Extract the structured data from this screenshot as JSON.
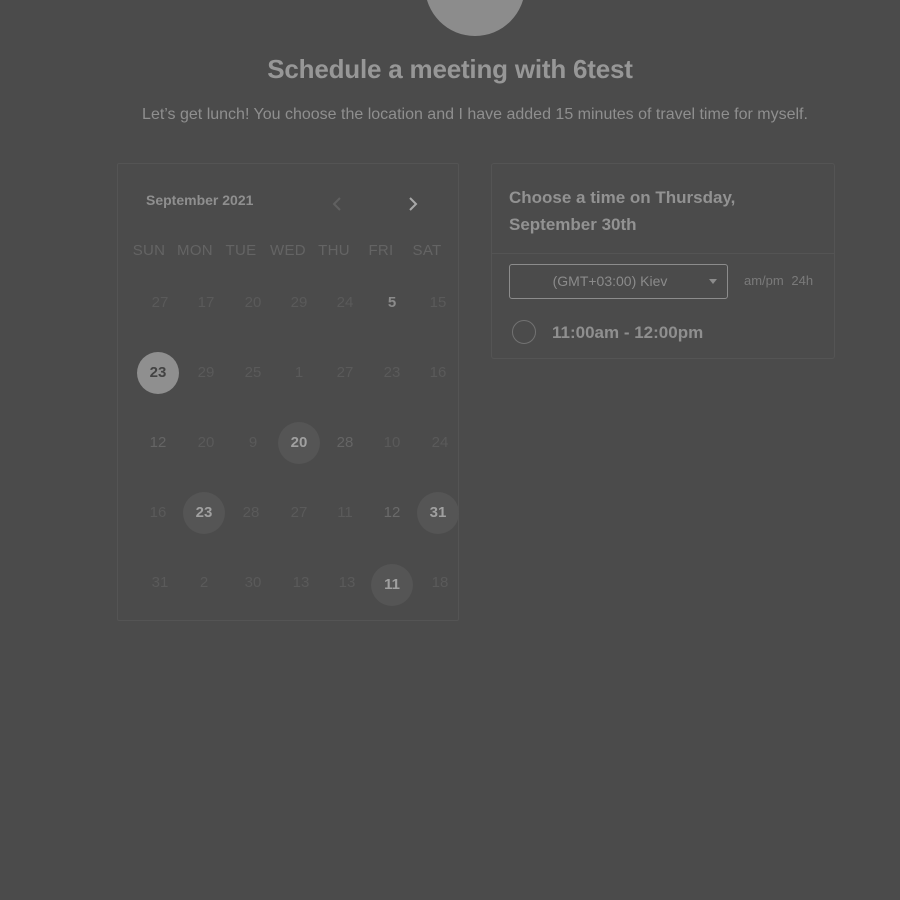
{
  "header": {
    "title": "Schedule a meeting with 6test",
    "subtitle": "Let’s get lunch! You choose the location and I have added 15 minutes of travel time for myself."
  },
  "calendar": {
    "month_label": "September 2021",
    "weekdays": [
      "SUN",
      "MON",
      "TUE",
      "WED",
      "THU",
      "FRI",
      "SAT"
    ],
    "weeks": [
      [
        "27",
        "17",
        "20",
        "29",
        "24",
        "5",
        "15"
      ],
      [
        "23",
        "29",
        "25",
        "1",
        "27",
        "23",
        "16"
      ],
      [
        "12",
        "20",
        "9",
        "20",
        "28",
        "10",
        "24"
      ],
      [
        "16",
        "23",
        "28",
        "27",
        "11",
        "12",
        "31"
      ],
      [
        "31",
        "2",
        "30",
        "13",
        "13",
        "11",
        "18"
      ]
    ]
  },
  "time_panel": {
    "heading": "Choose a time on Thursday, September 30th",
    "timezone_value": "(GMT+03:00) Kiev",
    "format_ampm": "am/pm",
    "format_24h": "24h",
    "slots": [
      {
        "label": "11:00am - 12:00pm"
      }
    ]
  },
  "icons": {
    "prev": "chevron-left-icon",
    "next": "chevron-right-icon",
    "caret": "caret-down-icon"
  }
}
